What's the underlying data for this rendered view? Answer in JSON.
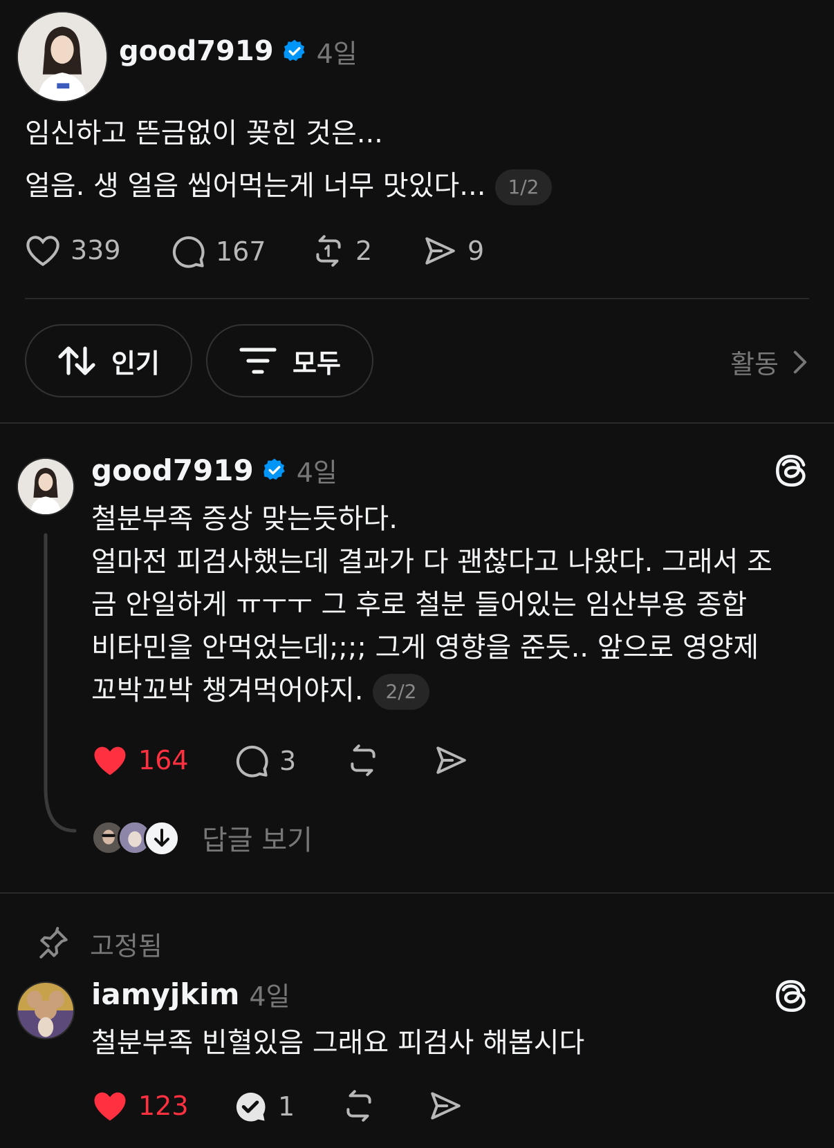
{
  "main_post": {
    "username": "good7919",
    "time": "4일",
    "lines": [
      "임신하고 뜬금없이 꽂힌 것은...",
      "얼음. 생 얼음 씹어먹는게 너무 맛있다..."
    ],
    "pager": "1/2",
    "likes": "339",
    "comments": "167",
    "reposts": "2",
    "shares": "9"
  },
  "sort_bar": {
    "sort_label": "인기",
    "filter_label": "모두",
    "activity_label": "활동"
  },
  "thread_reply": {
    "username": "good7919",
    "time": "4일",
    "lines": [
      "철분부족 증상 맞는듯하다.",
      "얼마전 피검사했는데 결과가 다 괜찮다고 나왔다. 그래서 조",
      "금 안일하게 ㅠㅜㅜ 그 후로 철분 들어있는 임산부용 종합",
      "비타민을 안먹었는데;;;; 그게 영향을 준듯.. 앞으로 영양제",
      "꼬박꼬박 챙겨먹어야지."
    ],
    "pager": "2/2",
    "likes": "164",
    "comments": "3",
    "view_replies": "답글 보기"
  },
  "pinned_comment": {
    "pinned_label": "고정됨",
    "username": "iamyjkim",
    "time": "4일",
    "text": "철분부족 빈혈있음 그래요 피검사 해봅시다",
    "likes": "123",
    "comments": "1"
  },
  "colors": {
    "background": "#101010",
    "like_red": "#ff3040",
    "verified_blue": "#0095f6",
    "muted_text": "#777777"
  }
}
